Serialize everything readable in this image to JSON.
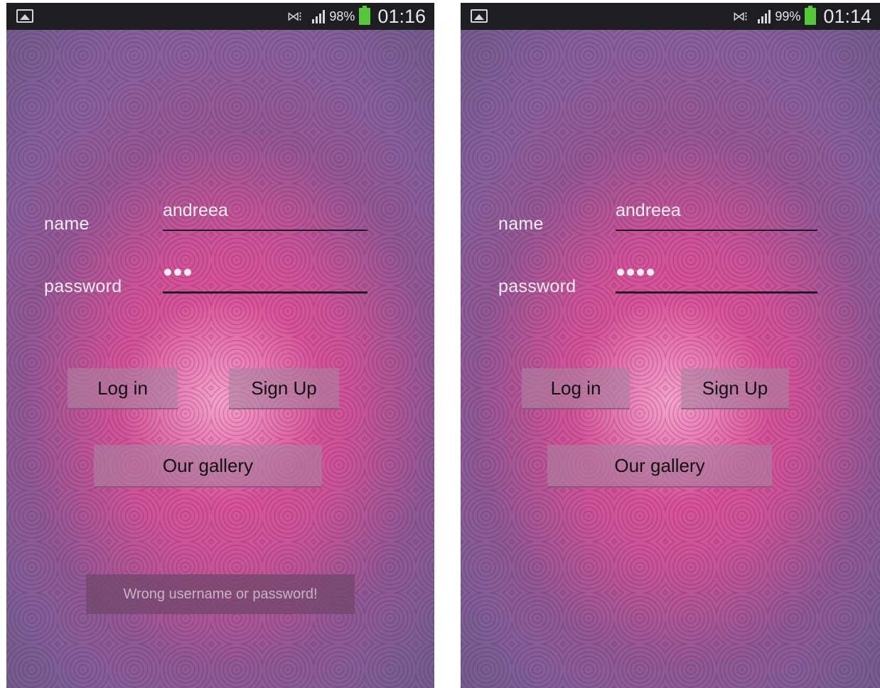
{
  "screens": [
    {
      "status": {
        "battery": "98%",
        "time": "01:16",
        "signal_bars": 4,
        "battery_color": "#55c83a"
      },
      "form": {
        "name_label": "name",
        "name_value": "andreea",
        "password_label": "password",
        "password_length": 3
      },
      "buttons": {
        "login": "Log in",
        "signup": "Sign Up",
        "gallery": "Our gallery"
      },
      "toast": "Wrong username or password!"
    },
    {
      "status": {
        "battery": "99%",
        "time": "01:14",
        "signal_bars": 4,
        "battery_color": "#55c83a"
      },
      "form": {
        "name_label": "name",
        "name_value": "andreea",
        "password_label": "password",
        "password_length": 4
      },
      "buttons": {
        "login": "Log in",
        "signup": "Sign Up",
        "gallery": "Our gallery"
      }
    }
  ],
  "icons": [
    "gallery-icon",
    "nfc-icon",
    "signal-icon",
    "battery-icon"
  ],
  "colors": {
    "accent_pink": "#e5579b",
    "statusbar": "#1e1e22",
    "underline": "#1e1e22"
  }
}
